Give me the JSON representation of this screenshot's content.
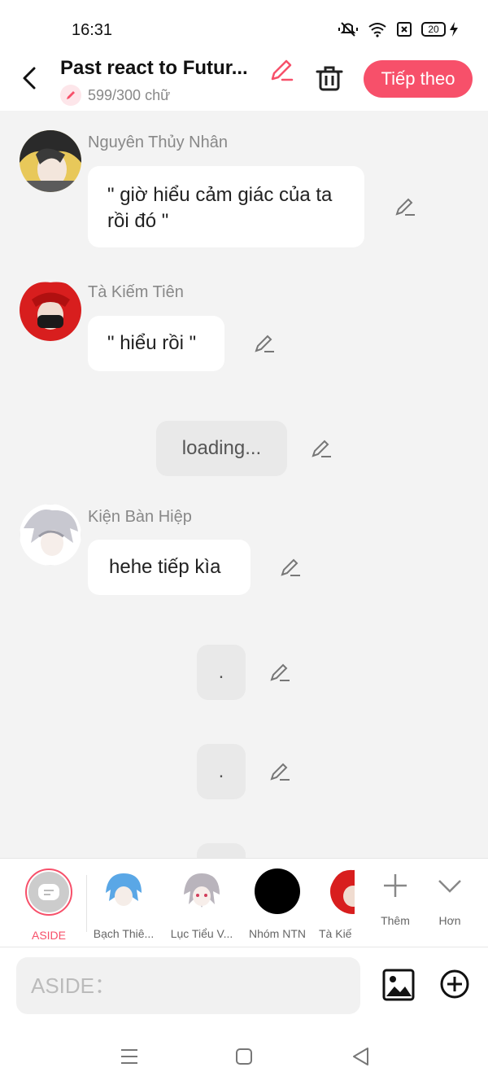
{
  "status": {
    "time": "16:31",
    "battery": "20"
  },
  "header": {
    "title": "Past react to Futur...",
    "word_count": "599/300 chữ",
    "next_label": "Tiếp theo"
  },
  "messages": [
    {
      "sender": "Nguyên Thủy Nhân",
      "text": "\" giờ hiểu cảm giác của ta rồi đó \""
    },
    {
      "sender": "Tà Kiếm Tiên",
      "text": "\" hiểu rồi \""
    },
    {
      "text": "loading..."
    },
    {
      "sender": "Kiện Bàn Hiệp",
      "text": "hehe tiếp kìa"
    },
    {
      "text": "."
    },
    {
      "text": "."
    }
  ],
  "characters": [
    {
      "label": "ASIDE",
      "color": "#f7506a"
    },
    {
      "label": "Bạch Thiê..."
    },
    {
      "label": "Lục Tiểu V..."
    },
    {
      "label": "Nhóm NTN"
    },
    {
      "label": "Tà Kiế"
    },
    {
      "label": "Thêm"
    },
    {
      "label": "Hơn"
    }
  ],
  "input": {
    "placeholder": "ASIDE："
  },
  "colors": {
    "accent": "#f7506a",
    "background": "#f3f3f3"
  }
}
